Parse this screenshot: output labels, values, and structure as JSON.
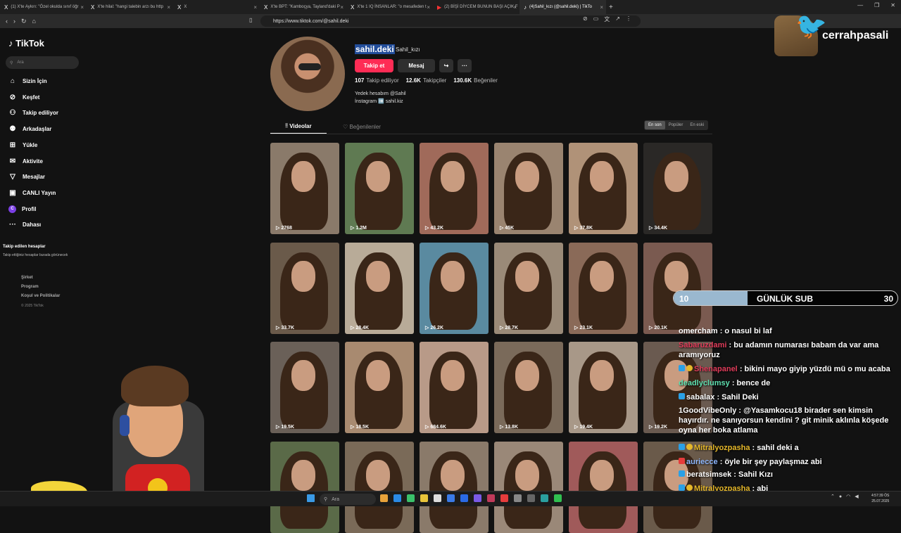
{
  "browser": {
    "tabs": [
      {
        "label": "(1) X'te Aykırı: \"Özel okulda sınıf öğr",
        "icon": "x-icon"
      },
      {
        "label": "X'te hilal: \"hangi talebin arzı bu http",
        "icon": "x-icon"
      },
      {
        "label": "X",
        "icon": "x-icon"
      },
      {
        "label": "X'te BPT: \"Kamboçya, Tayland'daki P",
        "icon": "x-icon"
      },
      {
        "label": "X'te 1 IQ İNSANLAR: \"o mesafeden t",
        "icon": "x-icon"
      },
      {
        "label": "(2) BİŞİ DİYCEM BUNUN BAŞI AÇIK F",
        "icon": "youtube-icon"
      },
      {
        "label": "(4)Sahil_kızı (@sahil.deki) | TikTo",
        "icon": "tiktok-icon"
      }
    ],
    "url": "https://www.tiktok.com/@sahil.deki"
  },
  "sidebar": {
    "logo": "TikTok",
    "search_placeholder": "Ara",
    "items": [
      {
        "label": "Sizin İçin",
        "icon": "home-icon"
      },
      {
        "label": "Keşfet",
        "icon": "compass-icon"
      },
      {
        "label": "Takip ediliyor",
        "icon": "following-icon"
      },
      {
        "label": "Arkadaşlar",
        "icon": "friends-icon"
      },
      {
        "label": "Yükle",
        "icon": "upload-icon"
      },
      {
        "label": "Aktivite",
        "icon": "activity-icon"
      },
      {
        "label": "Mesajlar",
        "icon": "messages-icon"
      },
      {
        "label": "CANLI Yayın",
        "icon": "live-icon"
      },
      {
        "label": "Profil",
        "icon": "profile-icon"
      },
      {
        "label": "Dahası",
        "icon": "more-icon"
      }
    ],
    "followed_title": "Takip edilen hesaplar",
    "followed_sub": "Takip ettiğiniz hesaplar burada görünecek",
    "footer": [
      "Şirket",
      "Program",
      "Koşul ve Politikalar"
    ],
    "copyright": "© 2025 TikTok"
  },
  "profile": {
    "username": "sahil.deki",
    "nickname": "Sahil_kızı",
    "follow_label": "Takip et",
    "message_label": "Mesaj",
    "following_count": "107",
    "following_label": "Takip ediliyor",
    "followers_count": "12.6K",
    "followers_label": "Takipçiler",
    "likes_count": "130.6K",
    "likes_label": "Beğeniler",
    "bio_line1": "Yedek hesabım @Sahil",
    "bio_line2": "İnstagram ➡️ sahil.kiz"
  },
  "content_tabs": {
    "videos": "Videolar",
    "liked": "Beğenilenler"
  },
  "sort": [
    "En son",
    "Popüler",
    "En eski"
  ],
  "videos": [
    {
      "views": "2768",
      "tone": "#8a7a6a"
    },
    {
      "views": "1.2M",
      "tone": "#5f7a52"
    },
    {
      "views": "43.2K",
      "tone": "#a06a5a"
    },
    {
      "views": "45K",
      "tone": "#9a8470"
    },
    {
      "views": "37.8K",
      "tone": "#b09278"
    },
    {
      "views": "34.4K",
      "tone": "#2a2826"
    },
    {
      "views": "33.7K",
      "tone": "#6a5a4a"
    },
    {
      "views": "28.4K",
      "tone": "#b8ab98"
    },
    {
      "views": "26.2K",
      "tone": "#5a8aa0"
    },
    {
      "views": "28.7K",
      "tone": "#9a8a78"
    },
    {
      "views": "23.1K",
      "tone": "#8a6a58"
    },
    {
      "views": "20.1K",
      "tone": "#7a5a50"
    },
    {
      "views": "19.5K",
      "tone": "#6a6058"
    },
    {
      "views": "18.5K",
      "tone": "#a88a70"
    },
    {
      "views": "684.6K",
      "tone": "#b89a88"
    },
    {
      "views": "13.8K",
      "tone": "#7a6a5a"
    },
    {
      "views": "19.4K",
      "tone": "#a89888"
    },
    {
      "views": "19.2K",
      "tone": "#6a5a50"
    },
    {
      "views": "",
      "tone": "#5a6a48"
    },
    {
      "views": "",
      "tone": "#7a6a58"
    },
    {
      "views": "",
      "tone": "#8a7a6a"
    },
    {
      "views": "",
      "tone": "#9a8878"
    },
    {
      "views": "",
      "tone": "#a05a5a"
    },
    {
      "views": "",
      "tone": "#6a5a4a"
    }
  ],
  "overlay": {
    "brand": "cerrahpasali",
    "sub_current": "10",
    "sub_label": "GÜNLÜK SUB",
    "sub_goal": "30",
    "sub_progress": 0.33,
    "chat": [
      {
        "user": "omercham",
        "color": "#ffffff",
        "text": ": o nasul bi laf",
        "badges": ""
      },
      {
        "user": "Sabaruzdami",
        "color": "#e03c5a",
        "text": ": bu adamın numarası babam da var ama aramıyoruz",
        "badges": ""
      },
      {
        "user": "Shenapanel",
        "color": "#e03c5a",
        "text": ": bikini mayo giyip yüzdü mü o mu acaba",
        "badges": "by"
      },
      {
        "user": "deadlyclumsy",
        "color": "#5fe0b0",
        "text": ": bence de",
        "badges": ""
      },
      {
        "user": "sabalax",
        "color": "#ffffff",
        "text": ": Sahil Deki",
        "badges": "b"
      },
      {
        "user": "1GoodVibeOnly",
        "color": "#ffffff",
        "text": ": @Yasamkocu18 birader sen kimsin hayırdır. ne sanıyorsun kendini ? git minik aklınla köşede oyna her boka atlama",
        "badges": ""
      },
      {
        "user": "Mitralyozpasha",
        "color": "#e6b82a",
        "text": ": sahil deki a",
        "badges": "by"
      },
      {
        "user": "auriecce",
        "color": "#8fb8ff",
        "text": ": öyle bir şey paylaşmaz abi",
        "badges": "r"
      },
      {
        "user": "beratsimsek",
        "color": "#ffffff",
        "text": ": Sahil Kızı",
        "badges": "b"
      },
      {
        "user": "Mitralyozpasha",
        "color": "#e6b82a",
        "text": ": abi",
        "badges": "by"
      }
    ]
  },
  "taskbar": {
    "search": "Ara",
    "time": "4:57:39 ÖS",
    "date": "25.07.2025"
  }
}
